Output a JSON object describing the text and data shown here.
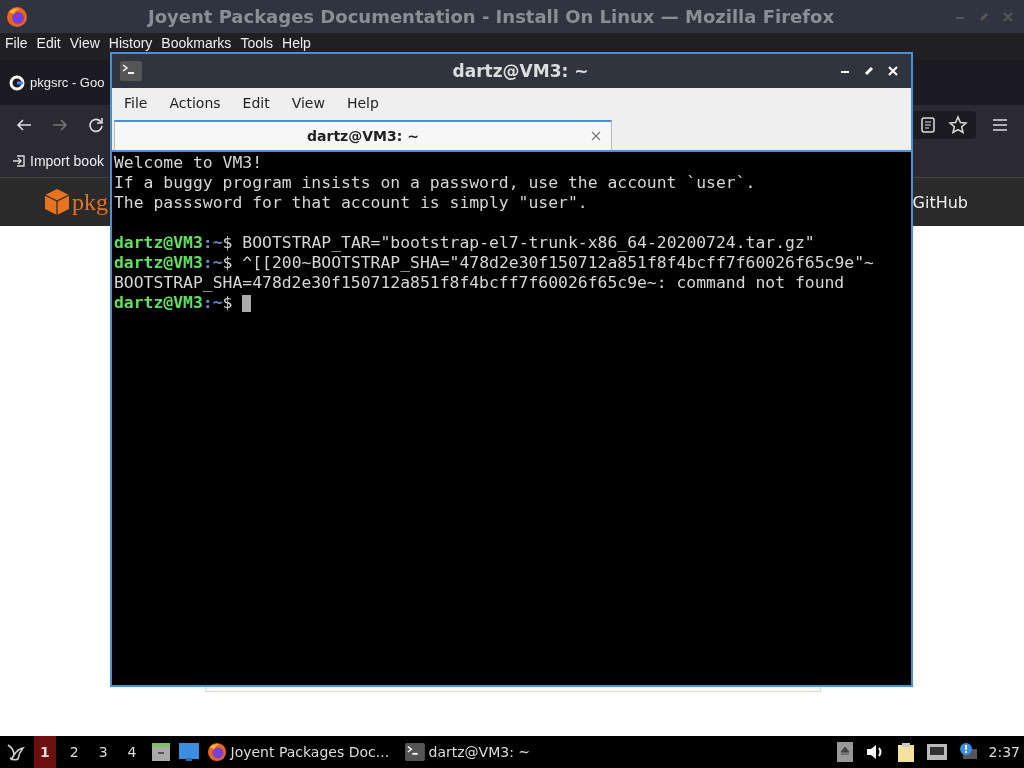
{
  "browser": {
    "title": "Joyent Packages Documentation - Install On Linux — Mozilla Firefox",
    "menu": [
      "File",
      "Edit",
      "View",
      "History",
      "Bookmarks",
      "Tools",
      "Help"
    ],
    "tab": {
      "label": "pkgsrc - Goo"
    },
    "bookmark": "Import book",
    "site_logo": "pkg",
    "site_link": "GitHub"
  },
  "terminal": {
    "title": "dartz@VM3: ~",
    "menu": [
      "File",
      "Actions",
      "Edit",
      "View",
      "Help"
    ],
    "tabs": [
      {
        "label": "dartz@VM3: ~",
        "selected": true
      }
    ],
    "lines": [
      {
        "kind": "text",
        "text": "Welcome to VM3!"
      },
      {
        "kind": "text",
        "text": "If a buggy program insists on a password, use the account `user`."
      },
      {
        "kind": "text",
        "text": "The passsword for that account is simply \"user\"."
      },
      {
        "kind": "blank"
      },
      {
        "kind": "prompt",
        "user": "dartz@VM3",
        "path": ":~",
        "symbol": "$",
        "command": "BOOTSTRAP_TAR=\"bootstrap-el7-trunk-x86_64-20200724.tar.gz\"",
        "cursor": false
      },
      {
        "kind": "prompt",
        "user": "dartz@VM3",
        "path": ":~",
        "symbol": "$",
        "command": "^[[200~BOOTSTRAP_SHA=\"478d2e30f150712a851f8f4bcff7f60026f65c9e\"~",
        "cursor": false
      },
      {
        "kind": "text",
        "text": "BOOTSTRAP_SHA=478d2e30f150712a851f8f4bcff7f60026f65c9e~: command not found"
      },
      {
        "kind": "prompt",
        "user": "dartz@VM3",
        "path": ":~",
        "symbol": "$",
        "cursor": true
      }
    ]
  },
  "taskbar": {
    "workspaces": [
      {
        "label": "1",
        "selected": true
      },
      {
        "label": "2",
        "selected": false
      },
      {
        "label": "3",
        "selected": false
      },
      {
        "label": "4",
        "selected": false
      }
    ],
    "windows": [
      {
        "kind": "browser",
        "label": "Joyent Packages Doc..."
      },
      {
        "kind": "terminal",
        "label": "dartz@VM3: ~"
      }
    ],
    "clock": "2:37"
  }
}
